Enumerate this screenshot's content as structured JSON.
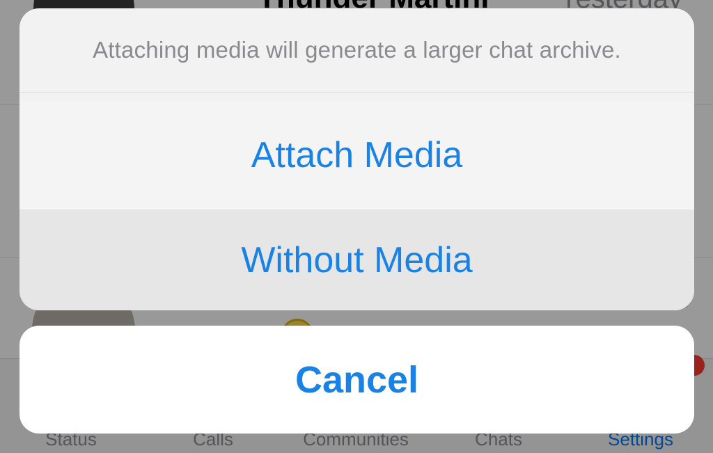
{
  "background": {
    "top_row": {
      "name": "Thunder Martini",
      "time": "Yesterday"
    },
    "tabs": [
      {
        "label": "Status",
        "active": false
      },
      {
        "label": "Calls",
        "active": false
      },
      {
        "label": "Communities",
        "active": false
      },
      {
        "label": "Chats",
        "active": false
      },
      {
        "label": "Settings",
        "active": true
      }
    ]
  },
  "action_sheet": {
    "message": "Attaching media will generate a larger chat archive.",
    "attach_label": "Attach Media",
    "without_label": "Without Media",
    "cancel_label": "Cancel"
  },
  "colors": {
    "accent": "#1a82e2",
    "message_text": "#8a8a8e",
    "destructive_badge": "#ff3b30"
  }
}
